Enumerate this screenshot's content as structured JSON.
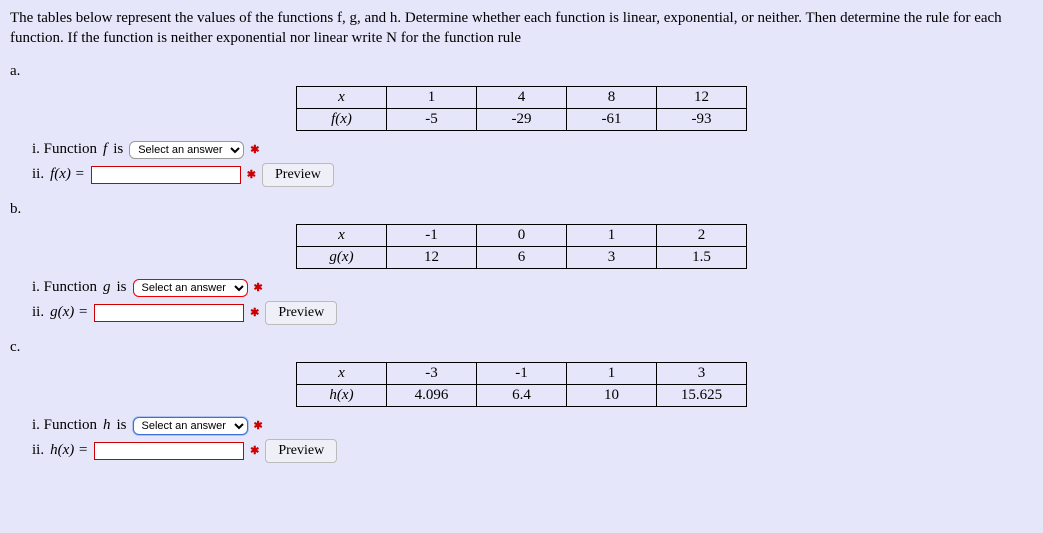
{
  "question": "The tables below represent the values of the functions f, g, and h. Determine whether each function is linear, exponential, or neither. Then determine the rule for each function. If the function is neither exponential nor linear write N for the function rule",
  "parts": {
    "a": {
      "label": "a.",
      "table": {
        "rowVar": "x",
        "rowFn": "f(x)",
        "x": [
          "1",
          "4",
          "8",
          "12"
        ],
        "y": [
          "-5",
          "-29",
          "-61",
          "-93"
        ]
      },
      "i_prefix": "i. Function ",
      "i_fn": "f",
      "i_suffix": "  is ",
      "select_placeholder": "Select an answer",
      "ii_prefix": "ii. ",
      "ii_fn": "f(x) = ",
      "preview": "Preview"
    },
    "b": {
      "label": "b.",
      "table": {
        "rowVar": "x",
        "rowFn": "g(x)",
        "x": [
          "-1",
          "0",
          "1",
          "2"
        ],
        "y": [
          "12",
          "6",
          "3",
          "1.5"
        ]
      },
      "i_prefix": "i.  Function ",
      "i_fn": "g",
      "i_suffix": "  is ",
      "select_placeholder": "Select an answer",
      "ii_prefix": "ii. ",
      "ii_fn": "g(x) = ",
      "preview": "Preview"
    },
    "c": {
      "label": "c.",
      "table": {
        "rowVar": "x",
        "rowFn": "h(x)",
        "x": [
          "-3",
          "-1",
          "1",
          "3"
        ],
        "y": [
          "4.096",
          "6.4",
          "10",
          "15.625"
        ]
      },
      "i_prefix": "i.  Function ",
      "i_fn": "h",
      "i_suffix": "  is ",
      "select_placeholder": "Select an answer",
      "ii_prefix": "ii. ",
      "ii_fn": "h(x) = ",
      "preview": "Preview"
    }
  },
  "asterisk": "✱"
}
